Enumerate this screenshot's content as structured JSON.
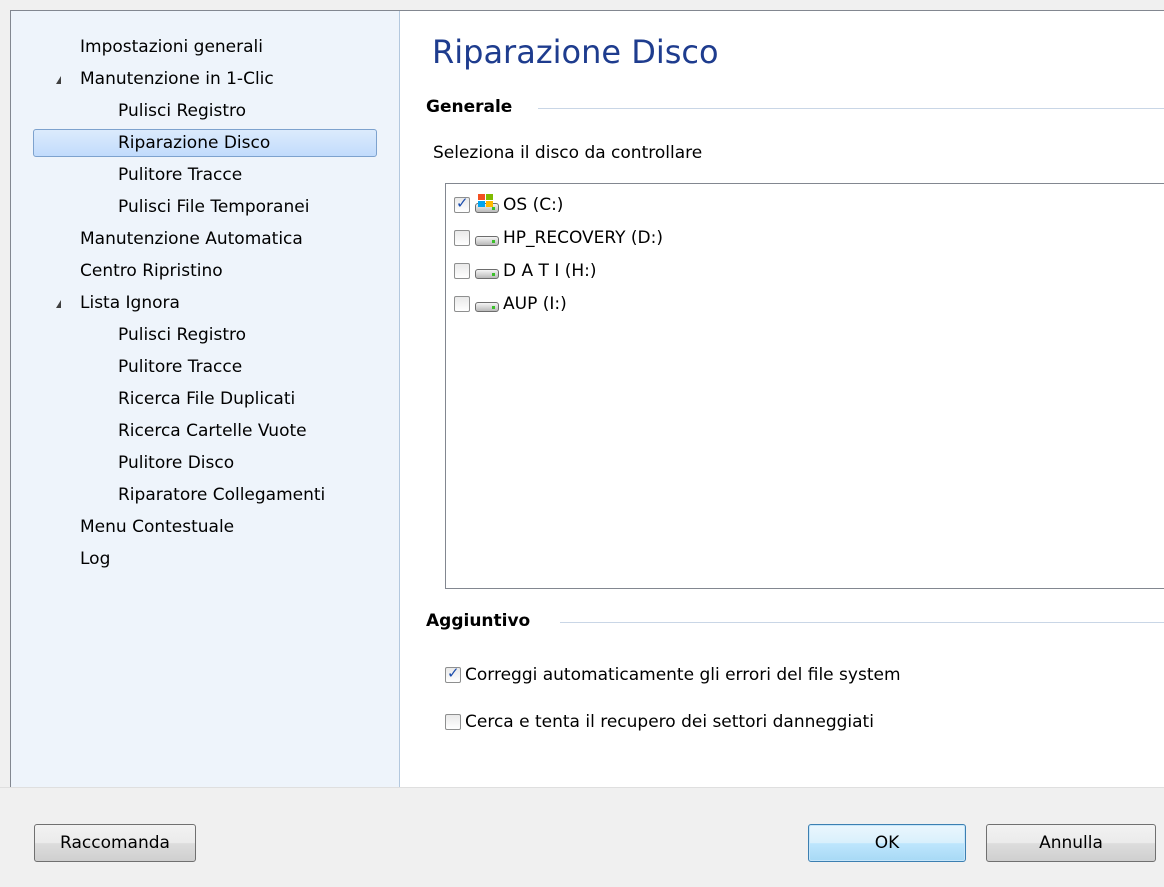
{
  "sidebar": {
    "items": [
      {
        "label": "Impostazioni generali"
      },
      {
        "label": "Manutenzione in 1-Clic"
      },
      {
        "label": "Pulisci Registro"
      },
      {
        "label": "Riparazione Disco"
      },
      {
        "label": "Pulitore Tracce"
      },
      {
        "label": "Pulisci File Temporanei"
      },
      {
        "label": "Manutenzione Automatica"
      },
      {
        "label": "Centro Ripristino"
      },
      {
        "label": "Lista Ignora"
      },
      {
        "label": "Pulisci Registro"
      },
      {
        "label": "Pulitore Tracce"
      },
      {
        "label": "Ricerca File Duplicati"
      },
      {
        "label": "Ricerca Cartelle Vuote"
      },
      {
        "label": "Pulitore Disco"
      },
      {
        "label": "Riparatore Collegamenti"
      },
      {
        "label": "Menu Contestuale"
      },
      {
        "label": "Log"
      }
    ],
    "selected": "Riparazione Disco"
  },
  "main": {
    "title": "Riparazione Disco",
    "general": {
      "heading": "Generale",
      "prompt": "Seleziona il disco da controllare",
      "disks": [
        {
          "label": "OS (C:)",
          "checked": true,
          "icon": "windows-drive-icon"
        },
        {
          "label": "HP_RECOVERY (D:)",
          "checked": false,
          "icon": "hard-drive-icon"
        },
        {
          "label": "D A T I (H:)",
          "checked": false,
          "icon": "hard-drive-icon"
        },
        {
          "label": "AUP (I:)",
          "checked": false,
          "icon": "hard-drive-icon"
        }
      ]
    },
    "additional": {
      "heading": "Aggiuntivo",
      "options": [
        {
          "label": "Correggi automaticamente gli errori del file system",
          "checked": true
        },
        {
          "label": "Cerca e tenta il recupero dei settori danneggiati",
          "checked": false
        }
      ]
    }
  },
  "footer": {
    "recommend": "Raccomanda",
    "ok": "OK",
    "cancel": "Annulla"
  }
}
